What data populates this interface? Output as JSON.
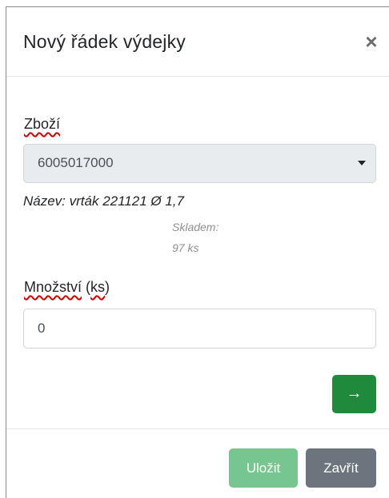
{
  "modal": {
    "title": "Nový řádek výdejky",
    "close_symbol": "×"
  },
  "form": {
    "product_label": "Zboží",
    "product_value": "6005017000",
    "name_text": "Název: vrták 221121 Ø 1,7",
    "stock_label": "Skladem:",
    "stock_value": "97 ks",
    "quantity_label_main": "Množství",
    "quantity_label_unit": "ks",
    "quantity_value": "0",
    "next_symbol": "→"
  },
  "footer": {
    "save_label": "Uložit",
    "close_label": "Zavřít"
  },
  "colors": {
    "next_button": "#1f8a3c",
    "save_button": "#77c58f",
    "close_button": "#6c757d",
    "select_background": "#e9ecef"
  },
  "icons": {
    "close": "close-icon",
    "caret": "chevron-down-icon",
    "next": "arrow-right-icon"
  }
}
